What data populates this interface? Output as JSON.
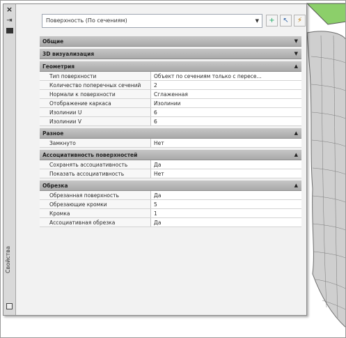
{
  "palette": {
    "title": "Свойства",
    "object_selector": "Поверхность (По сечениям)"
  },
  "sections": [
    {
      "label": "Общие",
      "expanded": false,
      "rows": []
    },
    {
      "label": "3D визуализация",
      "expanded": false,
      "rows": []
    },
    {
      "label": "Геометрия",
      "expanded": true,
      "rows": [
        {
          "k": "Тип поверхности",
          "v": "Объект по сечениям только с пересе..."
        },
        {
          "k": "Количество поперечных сечений",
          "v": "2"
        },
        {
          "k": "Нормали к поверхности",
          "v": "Сглаженная"
        },
        {
          "k": "Отображение каркаса",
          "v": "Изолинии"
        },
        {
          "k": "Изолинии U",
          "v": "6"
        },
        {
          "k": "Изолинии V",
          "v": "6"
        }
      ]
    },
    {
      "label": "Разное",
      "expanded": true,
      "rows": [
        {
          "k": "Замкнуто",
          "v": "Нет"
        }
      ]
    },
    {
      "label": "Ассоциативность поверхностей",
      "expanded": true,
      "rows": [
        {
          "k": "Сохранять ассоциативность",
          "v": "Да"
        },
        {
          "k": "Показать ассоциативность",
          "v": "Нет"
        }
      ]
    },
    {
      "label": "Обрезка",
      "expanded": true,
      "rows": [
        {
          "k": "Обрезанная поверхность",
          "v": "Да"
        },
        {
          "k": "Обрезающие кромки",
          "v": "5"
        },
        {
          "k": "Кромка",
          "v": "1"
        },
        {
          "k": "Ассоциативная обрезка",
          "v": "Да"
        }
      ]
    }
  ],
  "colors": {
    "viewport_green": "#8ccf6a",
    "viewport_mesh": "#6b6b6b"
  }
}
